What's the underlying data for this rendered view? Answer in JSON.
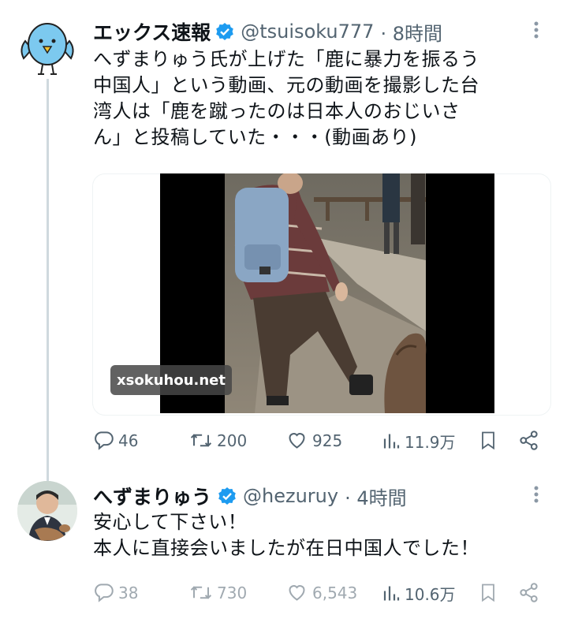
{
  "tweets": [
    {
      "name": "エックス速報",
      "handle": "@tsuisoku777",
      "time": "· 8時間",
      "lines": [
        "へずまりゅう氏が上げた「鹿に暴力を振るう",
        "中国人」という動画、元の動画を撮影した台",
        "湾人は「鹿を蹴ったのは日本人のおじいさ",
        "ん」と投稿していた・・・(動画あり)"
      ],
      "watermark": "xsokuhou.net",
      "replies": "46",
      "retweets": "200",
      "likes": "925",
      "views": "11.9万"
    },
    {
      "name": "へずまりゅう",
      "handle": "@hezuruy",
      "time": "· 4時間",
      "lines": [
        "安心して下さい！",
        "本人に直接会いましたが在日中国人でした！"
      ],
      "replies": "38",
      "retweets": "730",
      "likes": "6,543",
      "views": "10.6万"
    }
  ],
  "colors": {
    "verified": "#1d9bf0",
    "thread_line": "#cfd9de",
    "muted": "#536471"
  },
  "icons": [
    "reply-icon",
    "retweet-icon",
    "like-icon",
    "views-icon",
    "bookmark-icon",
    "share-icon",
    "more-icon",
    "verified-badge-icon"
  ]
}
